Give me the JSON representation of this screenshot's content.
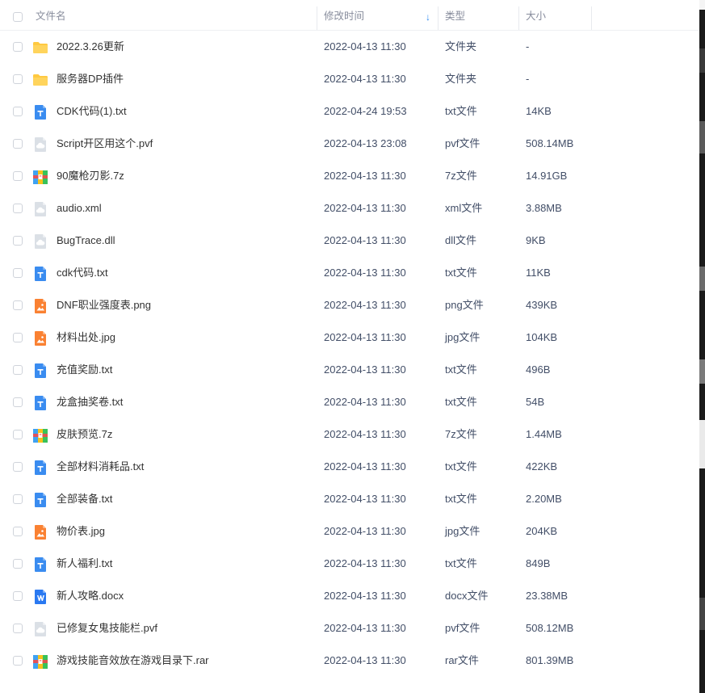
{
  "header": {
    "name": "文件名",
    "time": "修改时间",
    "sort_arrow": "↓",
    "type": "类型",
    "size": "大小"
  },
  "colors": {
    "folder": "#ffc941",
    "txt": "#3a8cf0",
    "image": "#fa8132",
    "word": "#2a79f1",
    "cloud": "#dbe0e6",
    "header_text": "#878c9c",
    "sort_arrow": "#2f8cf1"
  },
  "files": [
    {
      "name": "2022.3.26更新",
      "time": "2022-04-13 11:30",
      "type": "文件夹",
      "size": "-",
      "icon": "folder-icon"
    },
    {
      "name": "服务器DP插件",
      "time": "2022-04-13 11:30",
      "type": "文件夹",
      "size": "-",
      "icon": "folder-icon"
    },
    {
      "name": "CDK代码(1).txt",
      "time": "2022-04-24 19:53",
      "type": "txt文件",
      "size": "14KB",
      "icon": "txt-file-icon"
    },
    {
      "name": "Script开区用这个.pvf",
      "time": "2022-04-13 23:08",
      "type": "pvf文件",
      "size": "508.14MB",
      "icon": "unknown-file-icon"
    },
    {
      "name": "90魔枪刃影.7z",
      "time": "2022-04-13 11:30",
      "type": "7z文件",
      "size": "14.91GB",
      "icon": "archive-file-icon"
    },
    {
      "name": "audio.xml",
      "time": "2022-04-13 11:30",
      "type": "xml文件",
      "size": "3.88MB",
      "icon": "unknown-file-icon"
    },
    {
      "name": "BugTrace.dll",
      "time": "2022-04-13 11:30",
      "type": "dll文件",
      "size": "9KB",
      "icon": "unknown-file-icon"
    },
    {
      "name": "cdk代码.txt",
      "time": "2022-04-13 11:30",
      "type": "txt文件",
      "size": "11KB",
      "icon": "txt-file-icon"
    },
    {
      "name": "DNF职业强度表.png",
      "time": "2022-04-13 11:30",
      "type": "png文件",
      "size": "439KB",
      "icon": "image-file-icon"
    },
    {
      "name": "材料出处.jpg",
      "time": "2022-04-13 11:30",
      "type": "jpg文件",
      "size": "104KB",
      "icon": "image-file-icon"
    },
    {
      "name": "充值奖励.txt",
      "time": "2022-04-13 11:30",
      "type": "txt文件",
      "size": "496B",
      "icon": "txt-file-icon"
    },
    {
      "name": "龙盒抽奖卷.txt",
      "time": "2022-04-13 11:30",
      "type": "txt文件",
      "size": "54B",
      "icon": "txt-file-icon"
    },
    {
      "name": "皮肤预览.7z",
      "time": "2022-04-13 11:30",
      "type": "7z文件",
      "size": "1.44MB",
      "icon": "archive-file-icon"
    },
    {
      "name": "全部材料消耗品.txt",
      "time": "2022-04-13 11:30",
      "type": "txt文件",
      "size": "422KB",
      "icon": "txt-file-icon"
    },
    {
      "name": "全部装备.txt",
      "time": "2022-04-13 11:30",
      "type": "txt文件",
      "size": "2.20MB",
      "icon": "txt-file-icon"
    },
    {
      "name": "物价表.jpg",
      "time": "2022-04-13 11:30",
      "type": "jpg文件",
      "size": "204KB",
      "icon": "image-file-icon"
    },
    {
      "name": "新人福利.txt",
      "time": "2022-04-13 11:30",
      "type": "txt文件",
      "size": "849B",
      "icon": "txt-file-icon"
    },
    {
      "name": "新人攻略.docx",
      "time": "2022-04-13 11:30",
      "type": "docx文件",
      "size": "23.38MB",
      "icon": "word-file-icon"
    },
    {
      "name": "已修复女鬼技能栏.pvf",
      "time": "2022-04-13 11:30",
      "type": "pvf文件",
      "size": "508.12MB",
      "icon": "unknown-file-icon"
    },
    {
      "name": "游戏技能音效放在游戏目录下.rar",
      "time": "2022-04-13 11:30",
      "type": "rar文件",
      "size": "801.39MB",
      "icon": "archive-file-icon"
    }
  ]
}
